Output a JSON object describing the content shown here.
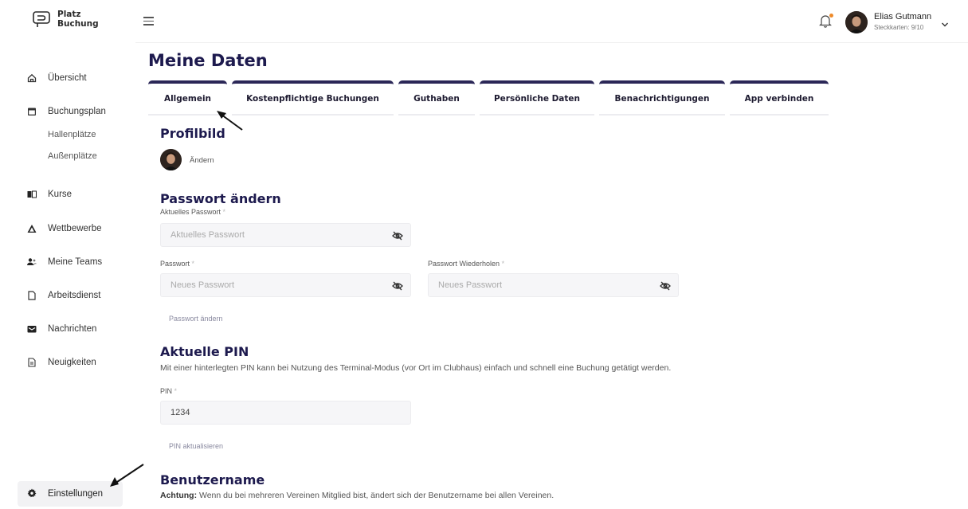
{
  "app": {
    "logo_line1": "Platz",
    "logo_line2": "Buchung"
  },
  "sidebar": {
    "items": [
      {
        "label": "Übersicht",
        "icon": "home-icon"
      },
      {
        "label": "Buchungsplan",
        "icon": "calendar-icon"
      },
      {
        "label": "Kurse",
        "icon": "book-icon"
      },
      {
        "label": "Wettbewerbe",
        "icon": "triangle-icon"
      },
      {
        "label": "Meine Teams",
        "icon": "team-icon"
      },
      {
        "label": "Arbeitsdienst",
        "icon": "document-icon"
      },
      {
        "label": "Nachrichten",
        "icon": "mail-icon"
      },
      {
        "label": "Neuigkeiten",
        "icon": "news-icon"
      }
    ],
    "subitems": [
      "Hallenplätze",
      "Außenplätze"
    ],
    "settings_label": "Einstellungen"
  },
  "header": {
    "user_name": "Elias Gutmann",
    "user_sub": "Steckkarten: 9/10",
    "notification_color": "#ee8a2a"
  },
  "main": {
    "title": "Meine Daten",
    "tabs": [
      {
        "label": "Allgemein",
        "active": true
      },
      {
        "label": "Kostenpflichtige Buchungen"
      },
      {
        "label": "Guthaben"
      },
      {
        "label": "Persönliche Daten"
      },
      {
        "label": "Benachrichtigungen"
      },
      {
        "label": "App verbinden"
      }
    ],
    "profile": {
      "heading": "Profilbild",
      "change_label": "Ändern"
    },
    "password": {
      "heading": "Passwort ändern",
      "current_label": "Aktuelles Passwort",
      "current_placeholder": "Aktuelles Passwort",
      "new_label": "Passwort",
      "new_placeholder": "Neues Passwort",
      "repeat_label": "Passwort Wiederholen",
      "repeat_placeholder": "Neues Passwort",
      "submit_label": "Passwort ändern",
      "required_mark": "*"
    },
    "pin": {
      "heading": "Aktuelle PIN",
      "description": "Mit einer hinterlegten PIN kann bei Nutzung des Terminal-Modus (vor Ort im Clubhaus) einfach und schnell eine Buchung getätigt werden.",
      "label": "PIN",
      "value": "1234",
      "submit_label": "PIN aktualisieren"
    },
    "username": {
      "heading": "Benutzername",
      "note_prefix": "Achtung:",
      "note_text": " Wenn du bei mehreren Vereinen Mitglied bist, ändert sich der Benutzername bei allen Vereinen."
    }
  },
  "colors": {
    "brand_dark": "#1d1a4e",
    "tab_bar": "#2b2757"
  }
}
